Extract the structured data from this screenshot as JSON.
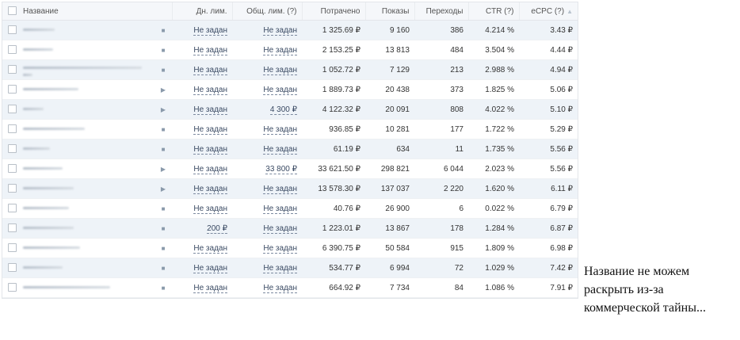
{
  "table": {
    "columns": {
      "name": "Название",
      "daily_limit": "Дн. лим.",
      "total_limit": "Общ. лим. (?)",
      "spent": "Потрачено",
      "impressions": "Показы",
      "clicks": "Переходы",
      "ctr": "CTR (?)",
      "ecpc": "eCPC (?)"
    },
    "rows": [
      {
        "status": "stopped",
        "status_icon": "■",
        "daily_limit": "Не задан",
        "total_limit": "Не задан",
        "spent": "1 325.69 ₽",
        "impressions": "9 160",
        "clicks": "386",
        "ctr": "4.214 %",
        "ecpc": "3.43 ₽"
      },
      {
        "status": "stopped",
        "status_icon": "■",
        "daily_limit": "Не задан",
        "total_limit": "Не задан",
        "spent": "2 153.25 ₽",
        "impressions": "13 813",
        "clicks": "484",
        "ctr": "3.504 %",
        "ecpc": "4.44 ₽"
      },
      {
        "status": "stopped",
        "status_icon": "■",
        "daily_limit": "Не задан",
        "total_limit": "Не задан",
        "spent": "1 052.72 ₽",
        "impressions": "7 129",
        "clicks": "213",
        "ctr": "2.988 %",
        "ecpc": "4.94 ₽"
      },
      {
        "status": "running",
        "status_icon": "▶",
        "daily_limit": "Не задан",
        "total_limit": "Не задан",
        "spent": "1 889.73 ₽",
        "impressions": "20 438",
        "clicks": "373",
        "ctr": "1.825 %",
        "ecpc": "5.06 ₽"
      },
      {
        "status": "running",
        "status_icon": "▶",
        "daily_limit": "Не задан",
        "total_limit": "4 300 ₽",
        "spent": "4 122.32 ₽",
        "impressions": "20 091",
        "clicks": "808",
        "ctr": "4.022 %",
        "ecpc": "5.10 ₽"
      },
      {
        "status": "stopped",
        "status_icon": "■",
        "daily_limit": "Не задан",
        "total_limit": "Не задан",
        "spent": "936.85 ₽",
        "impressions": "10 281",
        "clicks": "177",
        "ctr": "1.722 %",
        "ecpc": "5.29 ₽"
      },
      {
        "status": "stopped",
        "status_icon": "■",
        "daily_limit": "Не задан",
        "total_limit": "Не задан",
        "spent": "61.19 ₽",
        "impressions": "634",
        "clicks": "11",
        "ctr": "1.735 %",
        "ecpc": "5.56 ₽"
      },
      {
        "status": "running",
        "status_icon": "▶",
        "daily_limit": "Не задан",
        "total_limit": "33 800 ₽",
        "spent": "33 621.50 ₽",
        "impressions": "298 821",
        "clicks": "6 044",
        "ctr": "2.023 %",
        "ecpc": "5.56 ₽"
      },
      {
        "status": "running",
        "status_icon": "▶",
        "daily_limit": "Не задан",
        "total_limit": "Не задан",
        "spent": "13 578.30 ₽",
        "impressions": "137 037",
        "clicks": "2 220",
        "ctr": "1.620 %",
        "ecpc": "6.11 ₽"
      },
      {
        "status": "stopped",
        "status_icon": "■",
        "daily_limit": "Не задан",
        "total_limit": "Не задан",
        "spent": "40.76 ₽",
        "impressions": "26 900",
        "clicks": "6",
        "ctr": "0.022 %",
        "ecpc": "6.79 ₽"
      },
      {
        "status": "stopped",
        "status_icon": "■",
        "daily_limit": "200 ₽",
        "total_limit": "Не задан",
        "spent": "1 223.01 ₽",
        "impressions": "13 867",
        "clicks": "178",
        "ctr": "1.284 %",
        "ecpc": "6.87 ₽"
      },
      {
        "status": "stopped",
        "status_icon": "■",
        "daily_limit": "Не задан",
        "total_limit": "Не задан",
        "spent": "6 390.75 ₽",
        "impressions": "50 584",
        "clicks": "915",
        "ctr": "1.809 %",
        "ecpc": "6.98 ₽"
      },
      {
        "status": "stopped",
        "status_icon": "■",
        "daily_limit": "Не задан",
        "total_limit": "Не задан",
        "spent": "534.77 ₽",
        "impressions": "6 994",
        "clicks": "72",
        "ctr": "1.029 %",
        "ecpc": "7.42 ₽"
      },
      {
        "status": "stopped",
        "status_icon": "■",
        "daily_limit": "Не задан",
        "total_limit": "Не задан",
        "spent": "664.92 ₽",
        "impressions": "7 734",
        "clicks": "84",
        "ctr": "1.086 %",
        "ecpc": "7.91 ₽"
      }
    ]
  },
  "caption": {
    "lines": [
      "Название не можем",
      "раскрыть из-за",
      "коммерческой тайны..."
    ]
  }
}
